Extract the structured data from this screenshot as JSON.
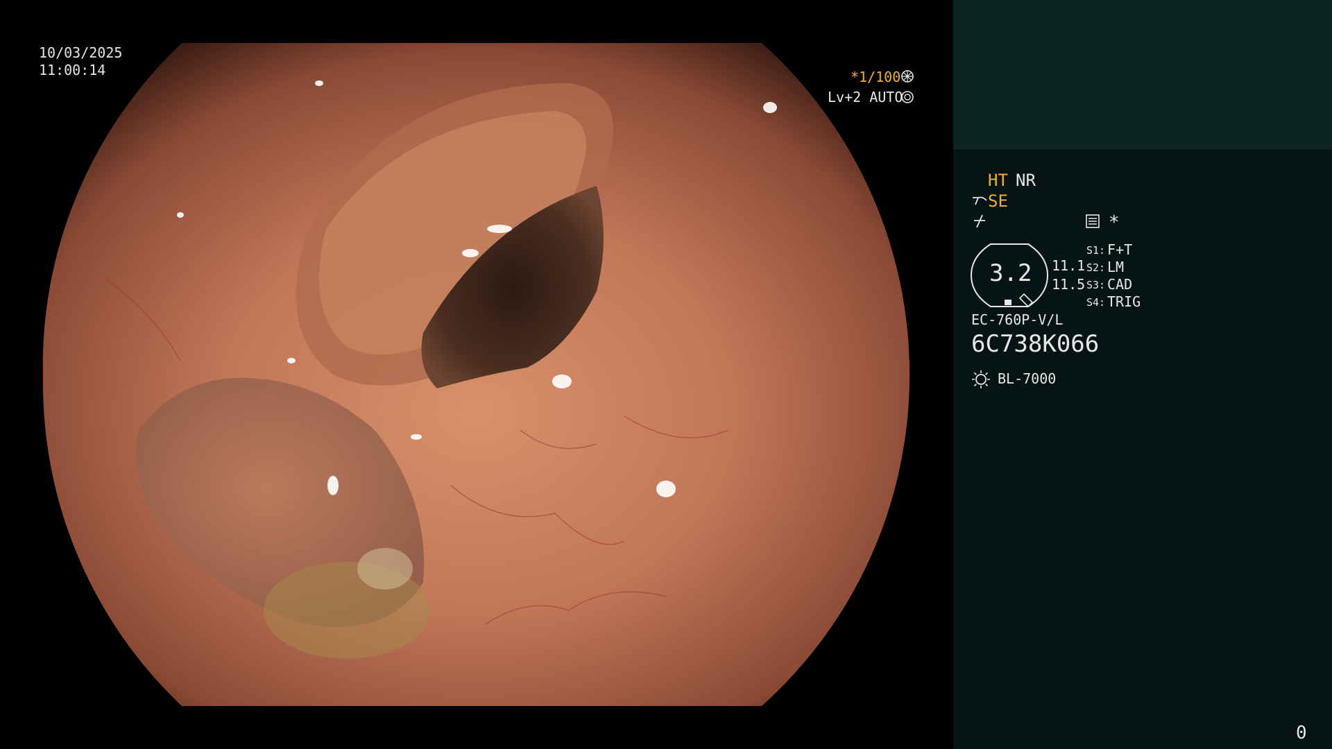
{
  "overlay": {
    "date": "10/03/2025",
    "time": "11:00:14",
    "shutter": "*1/100",
    "shutter_icon": "aperture-icon",
    "iris": "Lv+2 AUTO",
    "iris_icon": "iris-icon"
  },
  "panel": {
    "mode_ht": "HT",
    "mode_nr": "NR",
    "se_label": "SE",
    "star": "*",
    "zoom_value": "3.2",
    "val_1": "11.1",
    "val_2": "11.5",
    "switches": [
      {
        "key": "S1:",
        "value": "F+T"
      },
      {
        "key": "S2:",
        "value": "LM"
      },
      {
        "key": "S3:",
        "value": "CAD"
      },
      {
        "key": "S4:",
        "value": "TRIG"
      }
    ],
    "scope_model": "EC-760P-V/L",
    "serial": "6C738K066",
    "light_source": "BL-7000",
    "counter": "0"
  },
  "colors": {
    "orange": "#f0b030",
    "panel_bg": "#061513",
    "panel_top_bg": "#0d2522",
    "mucosa": "#c8785a"
  }
}
